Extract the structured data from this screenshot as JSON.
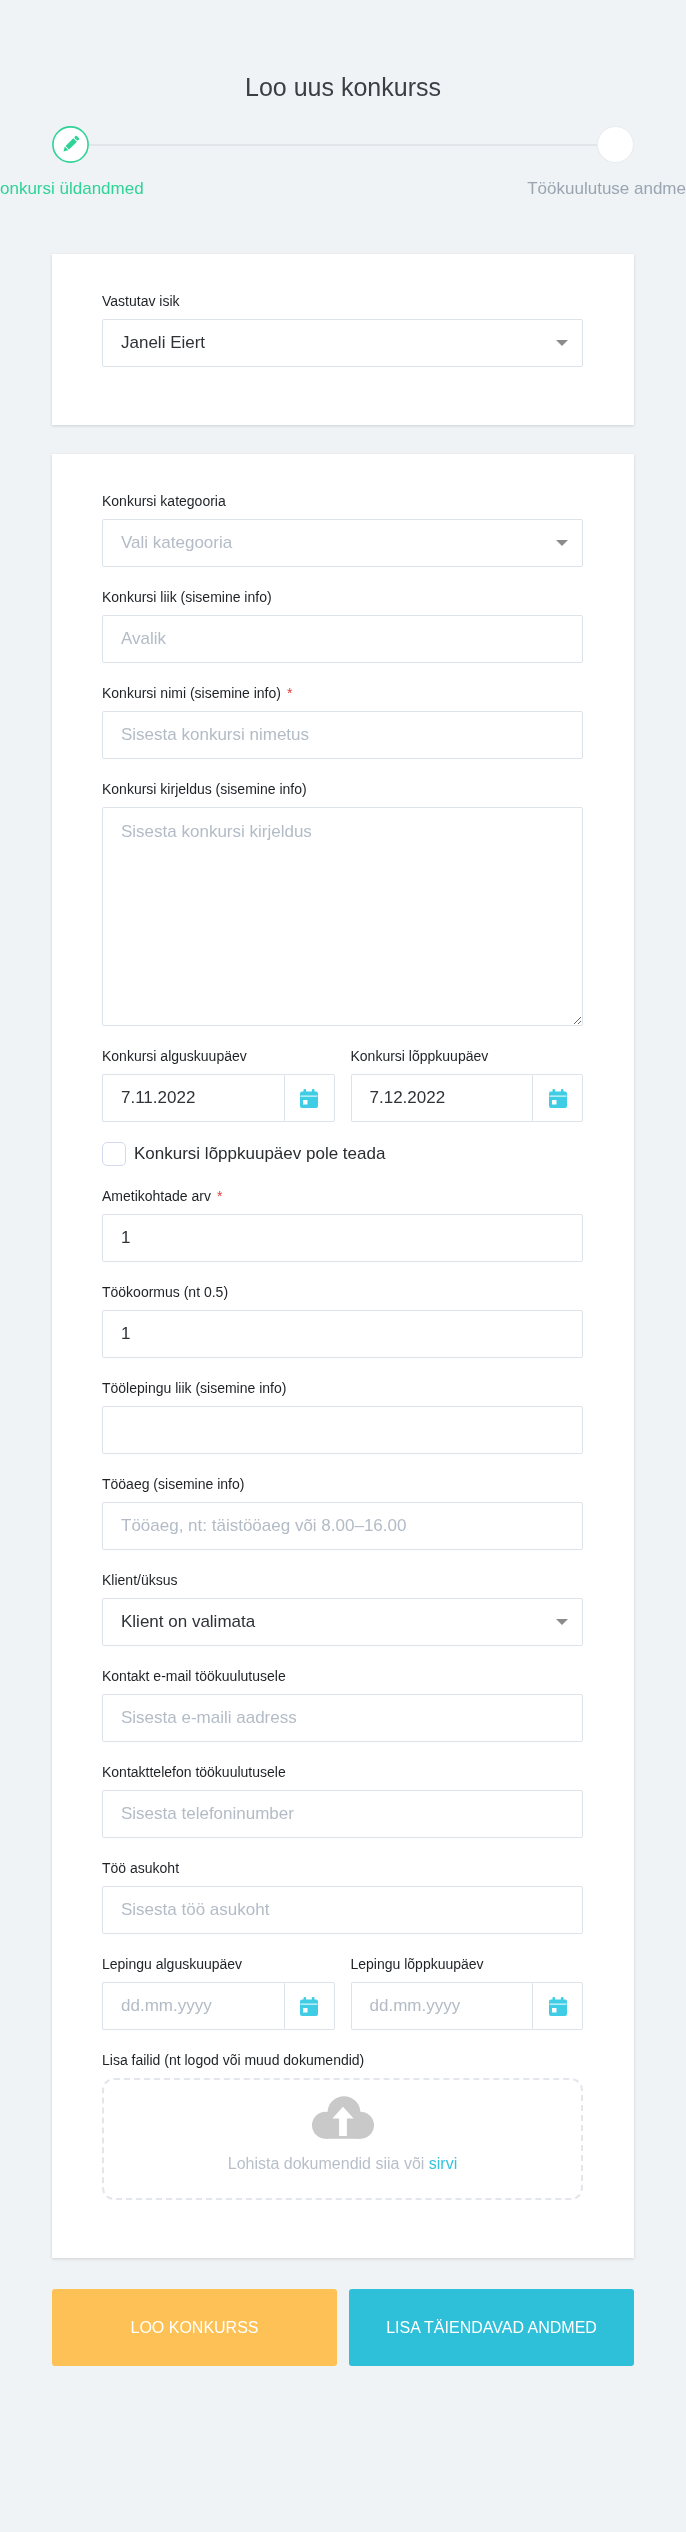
{
  "page": {
    "title": "Loo uus konkurss"
  },
  "stepper": {
    "steps": [
      {
        "label": "onkursi üldandmed",
        "selected": true
      },
      {
        "label": "Töökuulutuse andme",
        "selected": false
      }
    ]
  },
  "cards": [
    {
      "fields": [
        {
          "kind": "select",
          "label": "Vastutav isik",
          "value": "Janeli Eiert"
        }
      ]
    },
    {
      "fields": [
        {
          "kind": "select",
          "label": "Konkursi kategooria",
          "placeholder": "Vali kategooria"
        },
        {
          "kind": "text",
          "label": "Konkursi liik (sisemine info)",
          "placeholder": "Avalik"
        },
        {
          "kind": "text",
          "label": "Konkursi nimi (sisemine info)",
          "required_mark": "*",
          "placeholder": "Sisesta konkursi nimetus"
        },
        {
          "kind": "textarea",
          "label": "Konkursi kirjeldus (sisemine info)",
          "placeholder": "Sisesta konkursi kirjeldus"
        },
        {
          "kind": "date_pair",
          "dates": [
            {
              "label": "Konkursi alguskuupäev",
              "value": "7.11.2022"
            },
            {
              "label": "Konkursi lõppkuupäev",
              "value": "7.12.2022"
            }
          ]
        },
        {
          "kind": "checkbox",
          "label": "Konkursi lõppkuupäev pole teada",
          "checked": false
        },
        {
          "kind": "text",
          "label": "Ametikohtade arv",
          "required_mark": "*",
          "value": "1"
        },
        {
          "kind": "text",
          "label": "Töökoormus (nt 0.5)",
          "value": "1"
        },
        {
          "kind": "text",
          "label": "Töölepingu liik (sisemine info)"
        },
        {
          "kind": "text",
          "label": "Tööaeg (sisemine info)",
          "placeholder": "Tööaeg, nt: täistööaeg või 8.00–16.00"
        },
        {
          "kind": "select",
          "label": "Klient/üksus",
          "value": "Klient on valimata"
        },
        {
          "kind": "text",
          "label": "Kontakt e-mail töökuulutusele",
          "placeholder": "Sisesta e-maili aadress"
        },
        {
          "kind": "text",
          "label": "Kontakttelefon töökuulutusele",
          "placeholder": "Sisesta telefoninumber"
        },
        {
          "kind": "text",
          "label": "Töö asukoht",
          "placeholder": "Sisesta töö asukoht"
        },
        {
          "kind": "date_pair",
          "dates": [
            {
              "label": "Lepingu alguskuupäev",
              "placeholder": "dd.mm.yyyy"
            },
            {
              "label": "Lepingu lõppkuupäev",
              "placeholder": "dd.mm.yyyy"
            }
          ]
        },
        {
          "kind": "file_drop",
          "label": "Lisa failid (nt logod või muud dokumendid)",
          "hint": "Lohista dokumendid siia või",
          "link": "sirvi"
        }
      ]
    }
  ],
  "buttons": [
    {
      "kind": "primary",
      "label": "LOO KONKURSS"
    },
    {
      "kind": "secondary",
      "label": "LISA TÄIENDAVAD ANDMED"
    }
  ]
}
